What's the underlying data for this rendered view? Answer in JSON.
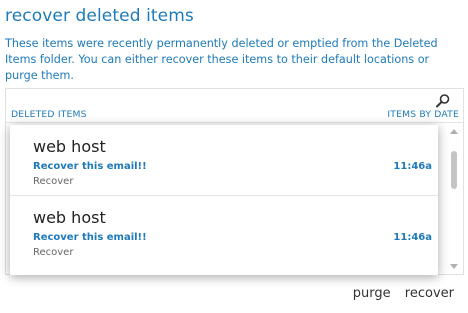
{
  "header": {
    "title": "recover deleted items",
    "description": "These items were recently permanently deleted or emptied from the Deleted Items folder. You can either recover these items to their default locations or purge them."
  },
  "panel": {
    "left_header": "DELETED ITEMS",
    "right_header": "ITEMS BY DATE",
    "search_icon": "search-icon"
  },
  "items": [
    {
      "sender": "web host",
      "subject": "Recover this email!!",
      "time": "11:46a",
      "action": "Recover"
    },
    {
      "sender": "web host",
      "subject": "Recover this email!!",
      "time": "11:46a",
      "action": "Recover"
    }
  ],
  "footer": {
    "purge_label": "purge",
    "recover_label": "recover"
  },
  "colors": {
    "accent": "#1e7ab8",
    "text": "#333333",
    "muted": "#666666"
  }
}
